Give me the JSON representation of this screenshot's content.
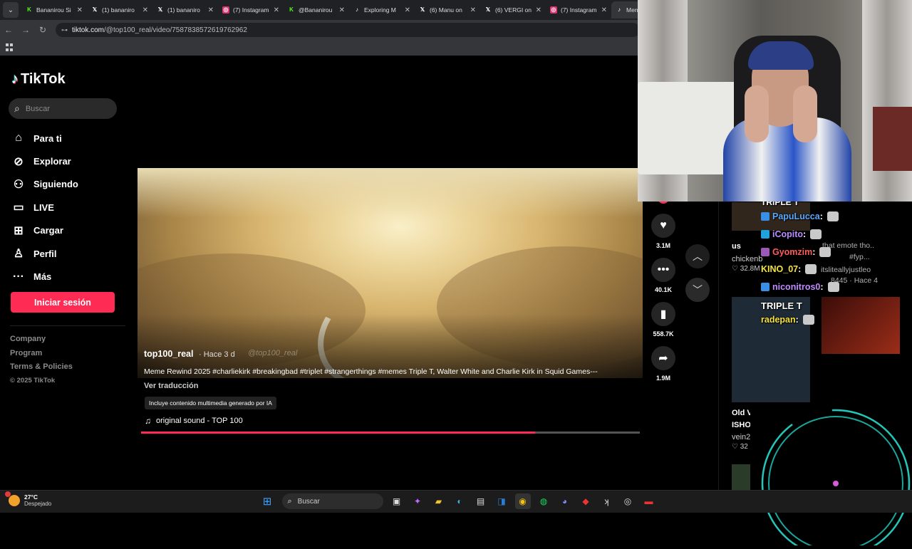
{
  "browser": {
    "tabs": [
      {
        "title": "Bananirou Si",
        "icon": "kick-icon",
        "color": "#53fc18"
      },
      {
        "title": "(1) bananiro",
        "icon": "x-icon",
        "color": "#ffffff"
      },
      {
        "title": "(1) bananiro",
        "icon": "x-icon",
        "color": "#ffffff"
      },
      {
        "title": "(7) Instagram",
        "icon": "instagram-icon",
        "color": "#e1306c"
      },
      {
        "title": "@Bananirou",
        "icon": "kick-icon",
        "color": "#53fc18"
      },
      {
        "title": "Exploring M",
        "icon": "tiktok-icon",
        "color": "#ffffff"
      },
      {
        "title": "(6) Manu on",
        "icon": "x-icon",
        "color": "#ffffff"
      },
      {
        "title": "(6) VERGI on",
        "icon": "x-icon",
        "color": "#ffffff"
      },
      {
        "title": "(7) Instagram",
        "icon": "instagram-icon",
        "color": "#e1306c"
      },
      {
        "title": "Mem",
        "icon": "tiktok-icon",
        "color": "#ffffff"
      }
    ],
    "url_host": "tiktok.com",
    "url_path": "/@top100_real/video/7587838572619762962"
  },
  "sidebar": {
    "logo": "TikTok",
    "search_placeholder": "Buscar",
    "menu": [
      {
        "label": "Para ti",
        "icon": "home-icon"
      },
      {
        "label": "Explorar",
        "icon": "compass-icon"
      },
      {
        "label": "Siguiendo",
        "icon": "following-icon"
      },
      {
        "label": "LIVE",
        "icon": "live-icon"
      },
      {
        "label": "Cargar",
        "icon": "upload-icon"
      },
      {
        "label": "Perfil",
        "icon": "profile-icon"
      },
      {
        "label": "Más",
        "icon": "more-icon"
      }
    ],
    "login_label": "Iniciar sesión",
    "footer": [
      "Company",
      "Program",
      "Terms & Policies"
    ],
    "copyright": "© 2025 TikTok"
  },
  "video": {
    "author": "top100_real",
    "time": "· Hace 3 d",
    "watermark": "@top100_real",
    "caption": "Meme Rewind 2025 #charliekirk #breakingbad #triplet #strangerthings #memes Triple T, Walter White and Charlie Kirk in Squid Games---",
    "translate": "Ver traducción",
    "ai_badge": "Incluye contenido multimedia generado por IA",
    "sound": "original sound - TOP 100",
    "progress": 0.79
  },
  "actions": [
    {
      "icon": "heart-icon",
      "count": "3.1M"
    },
    {
      "icon": "comment-icon",
      "count": "40.1K"
    },
    {
      "icon": "bookmark-icon",
      "count": "558.7K"
    },
    {
      "icon": "share-icon",
      "count": "1.9M"
    }
  ],
  "right_column": {
    "item1_user": "us",
    "item1_handle": "chickenb",
    "item1_views": "32.8M",
    "item2_title_a": "Old V",
    "item2_title_b": "ISHO",
    "item2_handle": "vein2",
    "item2_views": "32"
  },
  "chat": {
    "header": "TRIPLE T",
    "messages": [
      {
        "user": "PapuLucca",
        "color": "#5aa9ff",
        "badge": "#3a8ee6"
      },
      {
        "user": "iCopito",
        "color": "#b98cff",
        "badge": "#1fa3e0"
      },
      {
        "user": "Gyomzim",
        "color": "#ff5a5a",
        "badge": "#9b59b6"
      },
      {
        "user": "KINO_07",
        "color": "#f5e23a",
        "badge": ""
      },
      {
        "user": "niconitros0",
        "color": "#c08bff",
        "badge": "#3a8ee6"
      },
      {
        "user": "radepan",
        "color": "#f5e23a",
        "badge": ""
      }
    ],
    "banner": "TRIPLE T",
    "ghosts": [
      "that emote tho..",
      "#fyp...",
      "itsliteallyjustleo",
      "8445 · Hace 4"
    ]
  },
  "taskbar": {
    "temperature": "27°C",
    "condition": "Despejado",
    "search_label": "Buscar"
  }
}
